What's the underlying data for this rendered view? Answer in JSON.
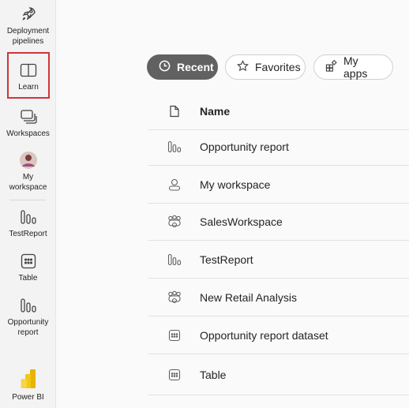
{
  "rail": {
    "items": [
      {
        "label_lines": [
          "Deployment",
          "pipelines"
        ],
        "icon": "rocket-icon"
      },
      {
        "label_lines": [
          "Learn"
        ],
        "icon": "book-icon"
      },
      {
        "label_lines": [
          "Workspaces"
        ],
        "icon": "workspaces-icon"
      },
      {
        "label_lines": [
          "My",
          "workspace"
        ],
        "icon": "avatar"
      },
      {
        "label_lines": [
          "TestReport"
        ],
        "icon": "report-icon"
      },
      {
        "label_lines": [
          "Table"
        ],
        "icon": "table-icon"
      },
      {
        "label_lines": [
          "Opportunity",
          "report"
        ],
        "icon": "report-icon"
      },
      {
        "label_lines": [
          "Power BI"
        ],
        "icon": "powerbi-logo-icon"
      }
    ]
  },
  "tabs": {
    "recent": "Recent",
    "favorites": "Favorites",
    "my_apps": "My apps"
  },
  "list": {
    "header": "Name",
    "rows": [
      {
        "name": "Opportunity report",
        "icon": "report-icon"
      },
      {
        "name": "My workspace",
        "icon": "person-icon"
      },
      {
        "name": "SalesWorkspace",
        "icon": "group-icon"
      },
      {
        "name": "TestReport",
        "icon": "report-icon"
      },
      {
        "name": "New Retail Analysis",
        "icon": "group-icon"
      },
      {
        "name": "Opportunity report dataset",
        "icon": "dataset-icon"
      },
      {
        "name": "Table",
        "icon": "dataset-icon"
      }
    ]
  },
  "colors": {
    "highlight": "#d13438",
    "active_tab": "#616161",
    "powerbi_yellow": "#f2c811"
  }
}
